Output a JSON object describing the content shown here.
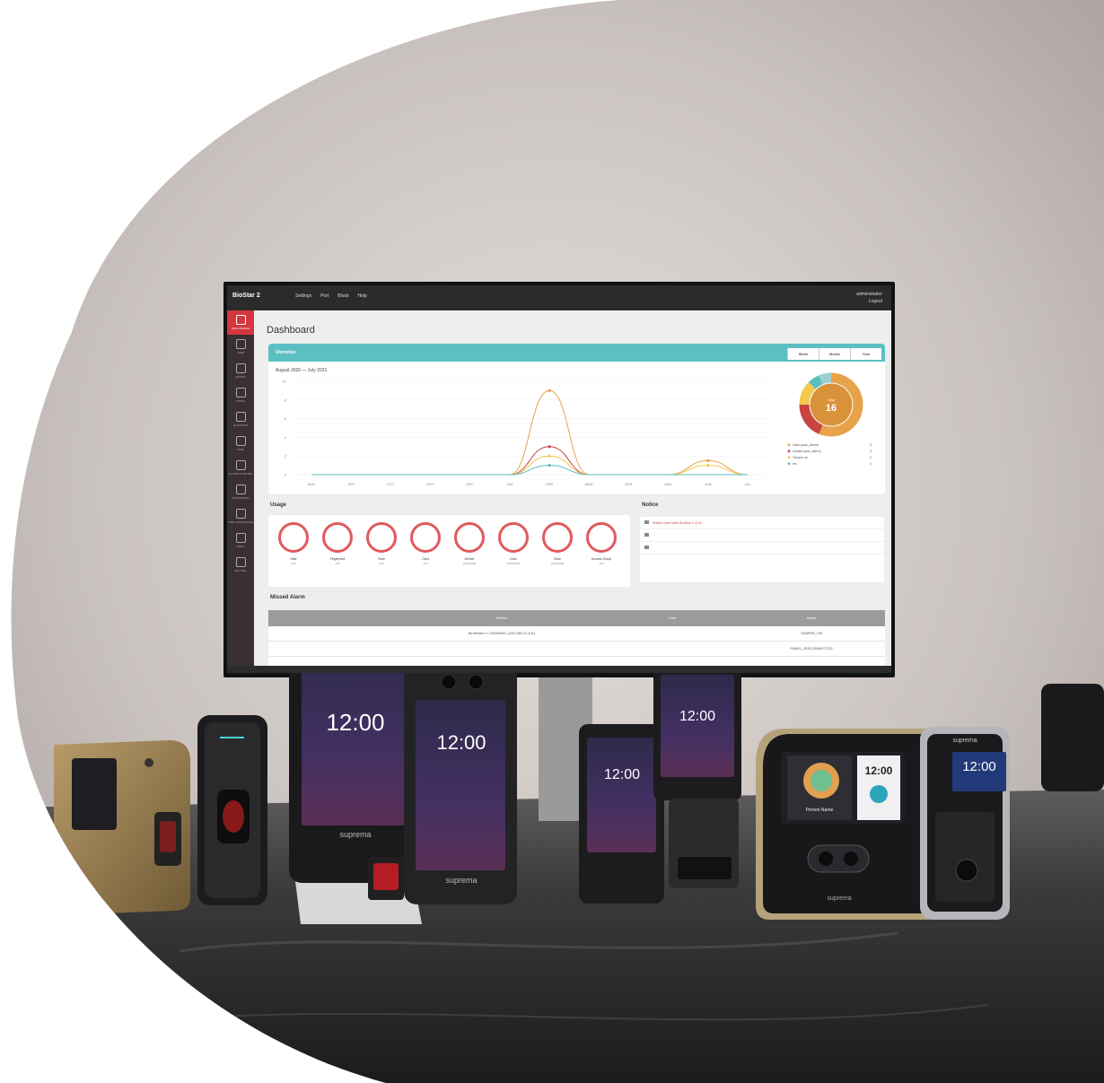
{
  "monitor": {
    "app_title": "BioStar 2",
    "menu": [
      "Settings",
      "Port",
      "Block",
      "Help"
    ],
    "user_name": "administrator",
    "logout_label": "Logout",
    "sidebar_items": [
      "DASH BOARD",
      "USER",
      "DEVICE",
      "DOOR",
      "ELEVATOR",
      "ZONE",
      "ACCESS CONTROL",
      "MONITORING",
      "TIME ATTENDANCE",
      "VIDEO",
      "SETTING"
    ],
    "page_title": "Dashboard",
    "overview": {
      "title": "Overview",
      "period_tabs": [
        "Week",
        "Month",
        "Year"
      ],
      "range_label": "August 2020 — July 2021"
    },
    "usage": {
      "title": "Usage",
      "items": [
        {
          "label": "User",
          "count": "120"
        },
        {
          "label": "Fingerprint",
          "count": "120"
        },
        {
          "label": "Face",
          "count": "120"
        },
        {
          "label": "Card",
          "count": "120"
        },
        {
          "label": "Device",
          "count": "1000/1000"
        },
        {
          "label": "Door",
          "count": "1000/1000"
        },
        {
          "label": "Zone",
          "count": "1000/1000"
        },
        {
          "label": "Access Group",
          "count": "100"
        }
      ]
    },
    "notice": {
      "title": "Notice",
      "rows": [
        "What's new with BioStar 2.8.11"
      ]
    },
    "missed_alarm": {
      "title": "Missed Alarm",
      "columns": [
        "",
        "Device",
        "Time",
        "Alarm"
      ],
      "rows": [
        [
          "",
          "BioStation 2 100000001 (192.168.12.101)",
          "",
          "TAMPER_ON"
        ],
        [
          "",
          "",
          "",
          "PANEL_DISCONNECTED"
        ]
      ]
    }
  },
  "chart_data": {
    "type": "line",
    "categories": [
      "AUG",
      "SEP",
      "OCT",
      "NOV",
      "DEC",
      "JAN",
      "FEB",
      "MAR",
      "APR",
      "MAY",
      "JUN",
      "JUL"
    ],
    "y_ticks": [
      "0",
      "2",
      "4",
      "6",
      "8",
      "10"
    ],
    "ylim": [
      0,
      10
    ],
    "series": [
      {
        "color": "#e8a24a",
        "values": [
          0,
          0,
          0,
          0,
          0,
          0,
          9,
          0,
          0,
          0,
          1.5,
          0
        ]
      },
      {
        "color": "#c9433f",
        "values": [
          0,
          0,
          0,
          0,
          0,
          0,
          3,
          0,
          0,
          0,
          0,
          0
        ]
      },
      {
        "color": "#f2c94c",
        "values": [
          0,
          0,
          0,
          0,
          0,
          0,
          2,
          0,
          0,
          0,
          1,
          0
        ]
      },
      {
        "color": "#5bbfbf",
        "values": [
          0,
          0,
          0,
          0,
          0,
          0,
          1,
          0,
          0,
          0,
          0,
          0
        ]
      }
    ],
    "donut": {
      "center_label": "Total",
      "center_value": "16",
      "segments": [
        {
          "color": "#e8a24a",
          "value": 9
        },
        {
          "color": "#c9433f",
          "value": 3
        },
        {
          "color": "#f2c94c",
          "value": 2
        },
        {
          "color": "#5bbfbf",
          "value": 1
        },
        {
          "color": "#9bd0d0",
          "value": 1
        }
      ],
      "legend": [
        {
          "label": "Valid (auto_alarm)",
          "value": "9"
        },
        {
          "label": "Invalid (auto_alarm)",
          "value": "3"
        },
        {
          "label": "Tamper on",
          "value": "2"
        },
        {
          "label": "etc",
          "value": "1"
        }
      ]
    }
  },
  "devices": {
    "clock_large": "12:00",
    "clock_small": "12:00",
    "brand": "suprema",
    "kiosk_name": "Person Name"
  }
}
